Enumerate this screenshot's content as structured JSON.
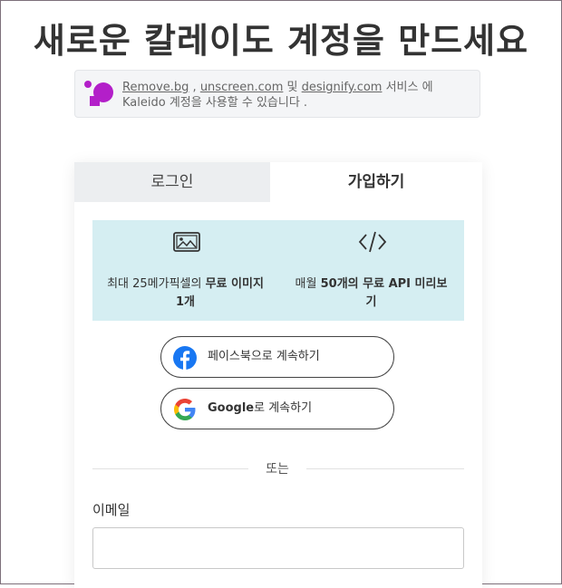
{
  "page": {
    "title": "새로운 칼레이도 계정을 만드세요"
  },
  "notice": {
    "link_removebg": "Remove.bg",
    "sep1": " , ",
    "link_unscreen": "unscreen.com",
    "sep2": " 및 ",
    "link_designify": "designify.com",
    "text_after": " 서비스 에 Kaleido 계정을 사용할 수 있습니다 ."
  },
  "tabs": {
    "login": "로그인",
    "signup": "가입하기"
  },
  "perks": {
    "left": {
      "prefix": "최대 25메가픽셀의 ",
      "bold": "무료 이미지 1개",
      "icon": "image-icon"
    },
    "right": {
      "prefix": "매월 ",
      "bold": "50개의 무료 API 미리보기",
      "icon": "code-icon"
    }
  },
  "social": {
    "facebook_label": "페이스북으로 계속하기",
    "google_brand": "Google",
    "google_suffix": "로 계속하기"
  },
  "divider": {
    "text": "또는"
  },
  "email": {
    "label": "이메일",
    "value": ""
  },
  "colors": {
    "perks_bg": "#d5eef2",
    "facebook_blue": "#1877f2",
    "kaleido_purple": "#b31fc9",
    "tab_inactive_bg": "#eceef0"
  }
}
